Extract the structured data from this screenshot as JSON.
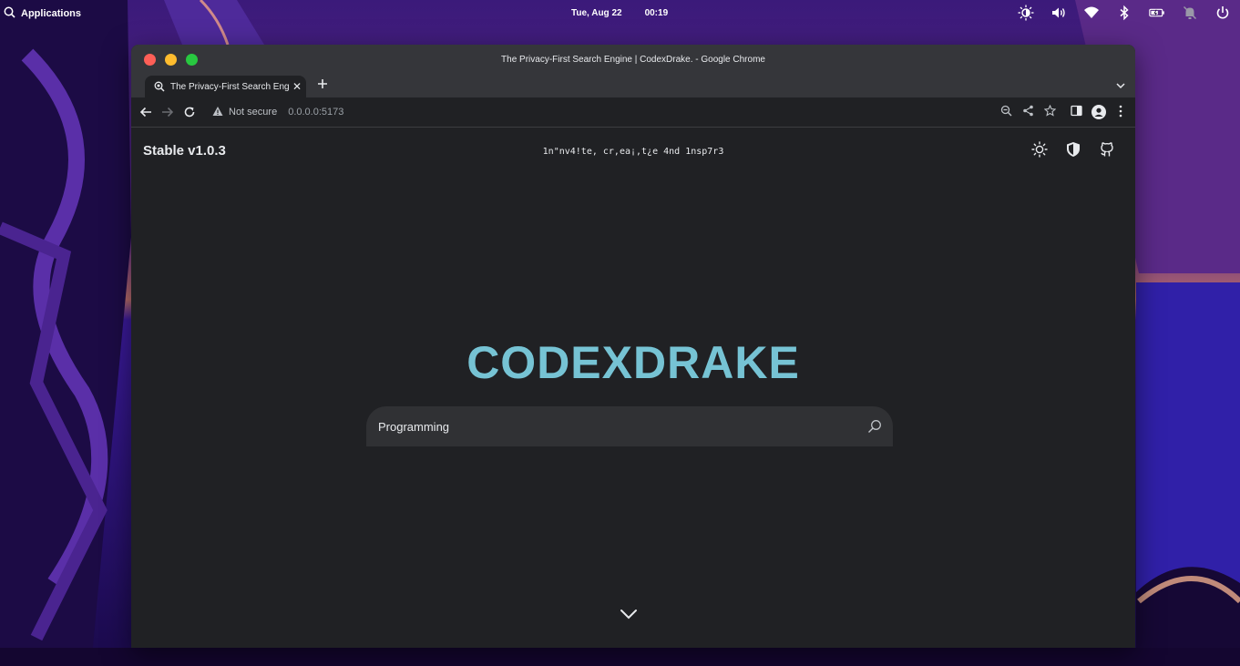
{
  "desktop": {
    "panel": {
      "apps_label": "Applications",
      "date": "Tue, Aug 22",
      "time": "00:19",
      "tray_icons": [
        "night-light-icon",
        "volume-icon",
        "wifi-icon",
        "bluetooth-icon",
        "battery-icon",
        "notifications-off-icon",
        "power-icon"
      ]
    }
  },
  "browser": {
    "window_title": "The Privacy-First Search Engine | CodexDrake. - Google Chrome",
    "tab": {
      "label": "The Privacy-First Search Engine | CodexDrake."
    },
    "omnibox": {
      "security_label": "Not secure",
      "url": "0.0.0.0:5173"
    }
  },
  "page": {
    "version": "Stable v1.0.3",
    "tagline": "1n\"nv4!te, cr,ea¡,t¿e 4nd 1nsp7r3",
    "logo": "CODEXDRAKE",
    "search": {
      "value": "Programming"
    }
  },
  "colors": {
    "accent": "#76c3d4",
    "page_bg": "#202124",
    "search_bg": "#303134"
  }
}
